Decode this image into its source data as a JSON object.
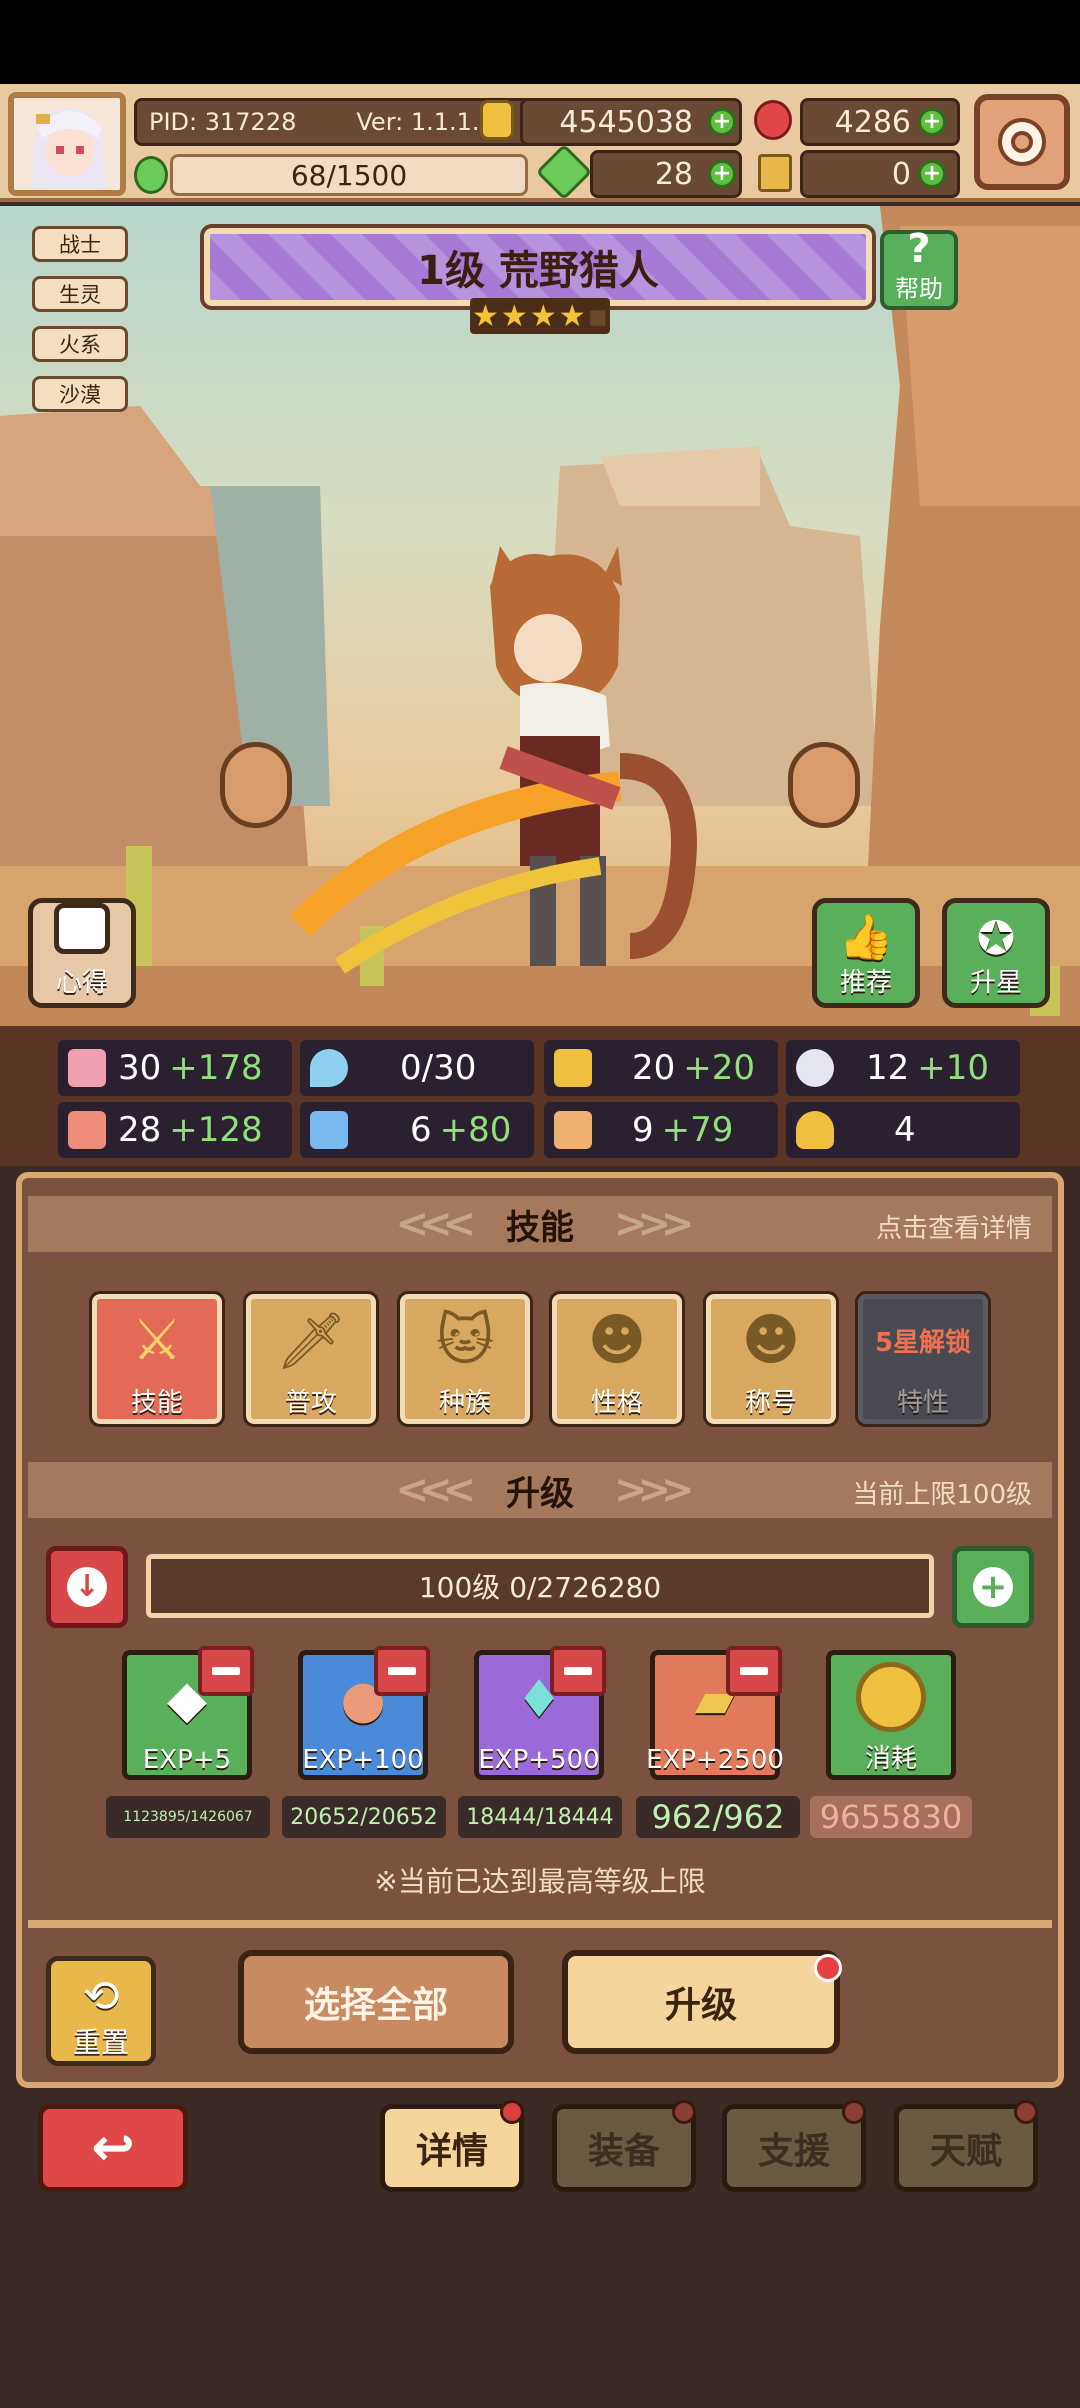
{
  "header": {
    "pid": "PID: 317228",
    "version": "Ver: 1.1.1.2",
    "gold": "4545038",
    "gems": "4286",
    "energy": "68/1500",
    "clover": "28",
    "tickets": "0"
  },
  "hero": {
    "tags": [
      "战士",
      "生灵",
      "火系",
      "沙漠"
    ],
    "title": "1级  荒野猎人",
    "stars": 4,
    "max_stars": 5,
    "help_label": "帮助",
    "notes_label": "心得",
    "recommend_label": "推荐",
    "star_up_label": "升星"
  },
  "stats": [
    {
      "icon": "heart-icon",
      "base": "30",
      "bonus": "+178"
    },
    {
      "icon": "water-drop-icon",
      "base": "0/30",
      "bonus": ""
    },
    {
      "icon": "shield-icon",
      "base": "20",
      "bonus": "+20"
    },
    {
      "icon": "wing-icon",
      "base": "12",
      "bonus": "+10"
    },
    {
      "icon": "fist-icon",
      "base": "28",
      "bonus": "+128"
    },
    {
      "icon": "book-icon",
      "base": "6",
      "bonus": "+80"
    },
    {
      "icon": "boot-icon",
      "base": "9",
      "bonus": "+79"
    },
    {
      "icon": "horseshoe-icon",
      "base": "4",
      "bonus": ""
    }
  ],
  "skills_section": {
    "title": "技能",
    "hint": "点击查看详情",
    "items": [
      {
        "label": "技能",
        "icon": "skill-icon"
      },
      {
        "label": "普攻",
        "icon": "sword-icon"
      },
      {
        "label": "种族",
        "icon": "cat-icon"
      },
      {
        "label": "性格",
        "icon": "person-icon"
      },
      {
        "label": "称号",
        "icon": "person-icon"
      },
      {
        "label": "特性",
        "icon": "locked-trait-icon",
        "locked_text": "5星解锁"
      }
    ]
  },
  "level_section": {
    "title": "升级",
    "hint": "当前上限100级",
    "progress": "100级  0/2726280",
    "items": [
      {
        "label": "EXP+5",
        "count": "1123895/1426067",
        "icon": "crystal-icon"
      },
      {
        "label": "EXP+100",
        "count": "20652/20652",
        "icon": "meat-icon"
      },
      {
        "label": "EXP+500",
        "count": "18444/18444",
        "icon": "gem-cluster-icon"
      },
      {
        "label": "EXP+2500",
        "count": "962/962",
        "icon": "gold-ingot-icon"
      },
      {
        "label": "消耗",
        "count": "9655830",
        "icon": "gold-coin-icon"
      }
    ],
    "notice": "※当前已达到最高等级上限",
    "reset_label": "重置",
    "select_all_label": "选择全部",
    "level_up_label": "升级"
  },
  "bottom_nav": {
    "tabs": [
      "详情",
      "装备",
      "支援",
      "天赋"
    ]
  },
  "colors": {
    "panel": "#7b5240",
    "banner": "#a67bd6",
    "accent_green": "#5fbf3f",
    "alert_red": "#d84848"
  }
}
